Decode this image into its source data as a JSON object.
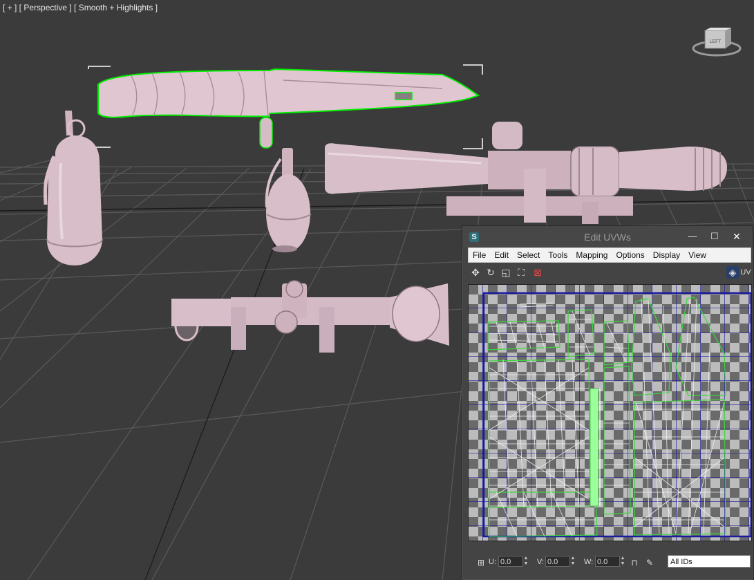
{
  "viewport": {
    "label": "[ + ] [ Perspective ] [ Smooth + Highlights ]",
    "viewcube_face": "LEFT"
  },
  "uvw_window": {
    "title": "Edit UVWs",
    "app_icon": "3ds-max-icon",
    "window_buttons": [
      "minimize-icon",
      "maximize-icon",
      "close-icon"
    ],
    "menu": [
      "File",
      "Edit",
      "Select",
      "Tools",
      "Mapping",
      "Options",
      "Display",
      "View"
    ],
    "toolbar_icons": [
      "move-icon",
      "rotate-icon",
      "scale-icon",
      "freeform-icon",
      "mirror-icon",
      "checker-map-icon"
    ],
    "toolbar_trailing_text": "UV",
    "status": {
      "u_label": "U:",
      "u_value": "0.0",
      "v_label": "V:",
      "v_value": "0.0",
      "w_label": "W:",
      "w_value": "0.0",
      "id_filter": "All IDs"
    }
  },
  "colors": {
    "viewport_bg": "#3b3b3b",
    "model": "#e4c8d4",
    "selection": "#00ff00",
    "uv_grid": "#1a1aa0"
  }
}
